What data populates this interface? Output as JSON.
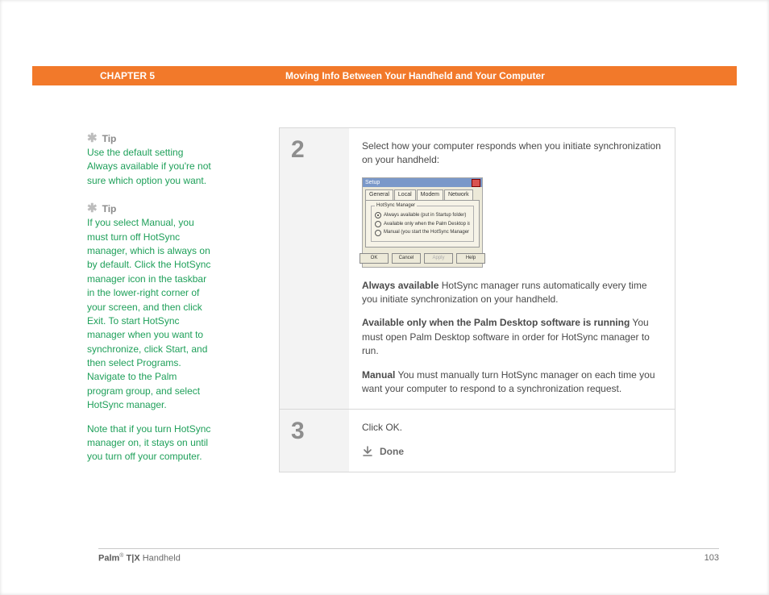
{
  "header": {
    "chapter": "CHAPTER 5",
    "title": "Moving Info Between Your Handheld and Your Computer"
  },
  "tips": [
    {
      "label": "Tip",
      "body": "Use the default setting Always available if you're not sure which option you want."
    },
    {
      "label": "Tip",
      "body_p1": "If you select Manual, you must turn off HotSync manager, which is always on by default. Click the HotSync manager icon in the taskbar in the lower-right corner of your screen, and then click Exit. To start HotSync manager when you want to synchronize, click Start, and then select Programs. Navigate to the Palm program group, and select HotSync manager.",
      "body_p2": "Note that if you turn HotSync manager on, it stays on until you turn off your computer."
    }
  ],
  "steps": {
    "s2": {
      "num": "2",
      "intro": "Select how your computer responds when you initiate synchronization on your handheld:",
      "dialog": {
        "title": "Setup",
        "tabs": [
          "General",
          "Local",
          "Modem",
          "Network"
        ],
        "group_legend": "HotSync Manager",
        "radios": [
          "Always available (put in Startup folder)",
          "Available only when the Palm Desktop is running",
          "Manual (you start the HotSync Manager yourself)"
        ],
        "buttons": {
          "ok": "OK",
          "cancel": "Cancel",
          "apply": "Apply",
          "help": "Help"
        }
      },
      "options": [
        {
          "label": "Always available",
          "text": "   HotSync manager runs automatically every time you initiate synchronization on your handheld."
        },
        {
          "label": "Available only when the Palm Desktop software is running",
          "text": "   You must open Palm Desktop software in order for HotSync manager to run."
        },
        {
          "label": "Manual",
          "text": "   You must manually turn HotSync manager on each time you want your computer to respond to a synchronization request."
        }
      ]
    },
    "s3": {
      "num": "3",
      "text": "Click OK.",
      "done": "Done"
    }
  },
  "footer": {
    "product_bold": "Palm",
    "product_reg": "®",
    "product_model": " T|X",
    "product_suffix": " Handheld",
    "page": "103"
  }
}
